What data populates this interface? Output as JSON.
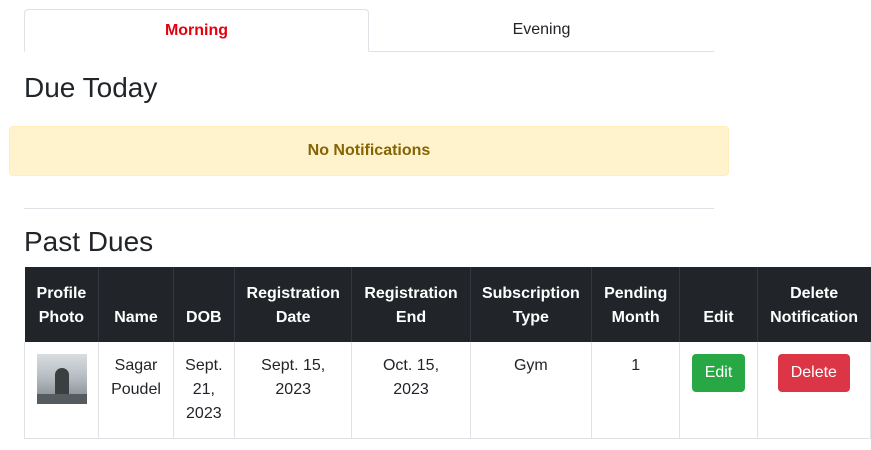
{
  "tabs": [
    {
      "label": "Morning",
      "active": true
    },
    {
      "label": "Evening",
      "active": false
    }
  ],
  "due_today": {
    "title": "Due Today",
    "alert": "No Notifications"
  },
  "past_dues": {
    "title": "Past Dues",
    "columns": [
      [
        "Profile",
        "Photo"
      ],
      [
        "Name"
      ],
      [
        "DOB"
      ],
      [
        "Registration",
        "Date"
      ],
      [
        "Registration",
        "End"
      ],
      [
        "Subscription",
        "Type"
      ],
      [
        "Pending",
        "Month"
      ],
      [
        "Edit"
      ],
      [
        "Delete",
        "Notification"
      ]
    ],
    "rows": [
      {
        "name": [
          "Sagar",
          "Poudel"
        ],
        "dob": [
          "Sept.",
          "21,",
          "2023"
        ],
        "registration_date": [
          "Sept. 15,",
          "2023"
        ],
        "registration_end": [
          "Oct. 15,",
          "2023"
        ],
        "subscription_type": "Gym",
        "pending_month": "1",
        "edit_label": "Edit",
        "delete_label": "Delete"
      }
    ]
  },
  "colors": {
    "active_tab": "#e3000f",
    "alert_bg": "#fff3cd",
    "alert_text": "#856404",
    "table_header_bg": "#212529",
    "edit_button": "#28a745",
    "delete_button": "#dc3545"
  }
}
